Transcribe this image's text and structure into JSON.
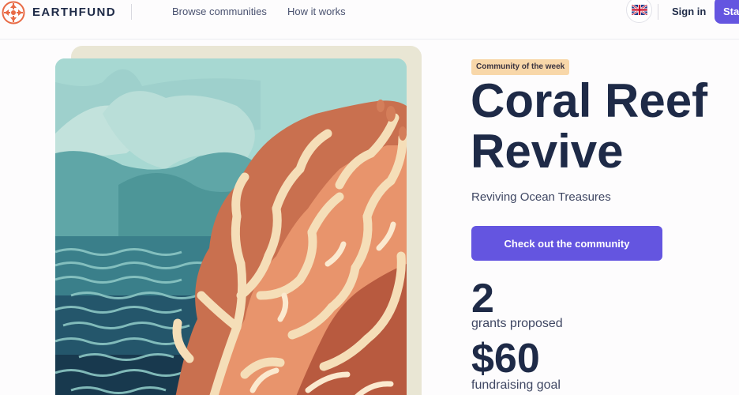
{
  "brand": {
    "name": "EARTHFUND",
    "logo": "earthfund-logo-icon"
  },
  "nav": {
    "browse_label": "Browse communities",
    "how_label": "How it works"
  },
  "header_actions": {
    "language_icon": "uk-flag-icon",
    "signin_label": "Sign in",
    "start_label": "Start"
  },
  "hero": {
    "image_icon": "coral-reef-illustration",
    "badge": "Community of the week",
    "title_line1": "Coral Reef",
    "title_line2": "Revive",
    "subtitle": "Reviving Ocean Treasures",
    "cta_label": "Check out the community",
    "stats": [
      {
        "value": "2",
        "label": "grants proposed"
      },
      {
        "value": "$60",
        "label": "fundraising goal"
      }
    ]
  },
  "colors": {
    "accent": "#6455e0",
    "badge_bg": "#f8d7a9",
    "text_dark": "#1e2a47",
    "coral": "#e8946c",
    "sea_dark": "#1f4f63"
  }
}
